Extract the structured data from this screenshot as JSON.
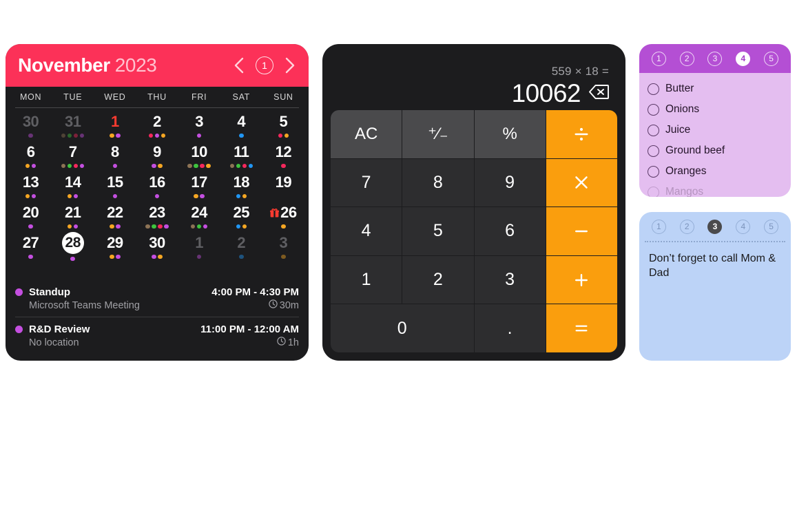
{
  "calendar": {
    "header": {
      "month": "November",
      "year": "2023",
      "prev_icon": "chevron-left-icon",
      "next_icon": "chevron-right-icon",
      "page_indicator": "1",
      "bg_color": "#fc3158"
    },
    "weekdays": [
      "MON",
      "TUE",
      "WED",
      "THU",
      "FRI",
      "SAT",
      "SUN"
    ],
    "dot_colors": {
      "purple": "#c44fe0",
      "orange": "#f5a623",
      "pink": "#f5285c",
      "brown": "#8d7355",
      "green": "#3ec33e",
      "blue": "#2196f3"
    },
    "days": [
      {
        "num": "30",
        "state": "dim",
        "dots": [
          "purple"
        ]
      },
      {
        "num": "31",
        "state": "dim",
        "dots": [
          "brown",
          "green",
          "pink",
          "purple"
        ]
      },
      {
        "num": "1",
        "state": "accent",
        "dots": [
          "orange",
          "purple"
        ]
      },
      {
        "num": "2",
        "state": "normal",
        "dots": [
          "pink",
          "purple",
          "orange"
        ]
      },
      {
        "num": "3",
        "state": "normal",
        "dots": [
          "purple"
        ]
      },
      {
        "num": "4",
        "state": "normal",
        "dots": [
          "blue"
        ]
      },
      {
        "num": "5",
        "state": "normal",
        "dots": [
          "pink",
          "orange"
        ]
      },
      {
        "num": "6",
        "state": "normal",
        "dots": [
          "orange",
          "purple"
        ]
      },
      {
        "num": "7",
        "state": "normal",
        "dots": [
          "brown",
          "green",
          "pink",
          "purple"
        ]
      },
      {
        "num": "8",
        "state": "normal",
        "dots": [
          "purple"
        ]
      },
      {
        "num": "9",
        "state": "normal",
        "dots": [
          "purple",
          "orange"
        ]
      },
      {
        "num": "10",
        "state": "normal",
        "dots": [
          "brown",
          "green",
          "pink",
          "orange"
        ]
      },
      {
        "num": "11",
        "state": "normal",
        "dots": [
          "brown",
          "green",
          "pink",
          "blue"
        ]
      },
      {
        "num": "12",
        "state": "normal",
        "dots": [
          "pink"
        ]
      },
      {
        "num": "13",
        "state": "normal",
        "dots": [
          "orange",
          "purple"
        ]
      },
      {
        "num": "14",
        "state": "normal",
        "dots": [
          "orange",
          "purple"
        ]
      },
      {
        "num": "15",
        "state": "normal",
        "dots": [
          "purple"
        ]
      },
      {
        "num": "16",
        "state": "normal",
        "dots": [
          "purple"
        ]
      },
      {
        "num": "17",
        "state": "normal",
        "dots": [
          "orange",
          "purple"
        ]
      },
      {
        "num": "18",
        "state": "normal",
        "dots": [
          "blue",
          "orange"
        ]
      },
      {
        "num": "19",
        "state": "normal",
        "dots": []
      },
      {
        "num": "20",
        "state": "normal",
        "dots": [
          "purple"
        ]
      },
      {
        "num": "21",
        "state": "normal",
        "dots": [
          "orange",
          "purple"
        ]
      },
      {
        "num": "22",
        "state": "normal",
        "dots": [
          "orange",
          "purple"
        ]
      },
      {
        "num": "23",
        "state": "normal",
        "dots": [
          "brown",
          "green",
          "pink",
          "purple"
        ]
      },
      {
        "num": "24",
        "state": "normal",
        "dots": [
          "brown",
          "green",
          "purple"
        ]
      },
      {
        "num": "25",
        "state": "normal",
        "dots": [
          "blue",
          "orange"
        ]
      },
      {
        "num": "26",
        "state": "normal",
        "dots": [
          "orange"
        ],
        "icon": "gift-icon"
      },
      {
        "num": "27",
        "state": "normal",
        "dots": [
          "purple"
        ]
      },
      {
        "num": "28",
        "state": "today",
        "dots": [
          "purple"
        ]
      },
      {
        "num": "29",
        "state": "normal",
        "dots": [
          "orange",
          "purple"
        ]
      },
      {
        "num": "30",
        "state": "normal",
        "dots": [
          "purple",
          "orange"
        ]
      },
      {
        "num": "1",
        "state": "dim",
        "dots": [
          "purple"
        ]
      },
      {
        "num": "2",
        "state": "dim",
        "dots": [
          "blue"
        ]
      },
      {
        "num": "3",
        "state": "dim",
        "dots": [
          "orange"
        ]
      }
    ],
    "events": [
      {
        "dot_color": "#c44fe0",
        "title": "Standup",
        "location": "Microsoft Teams Meeting",
        "time": "4:00 PM - 4:30 PM",
        "duration": "30m",
        "duration_icon": "clock-icon"
      },
      {
        "dot_color": "#c44fe0",
        "title": "R&D Review",
        "location": "No location",
        "time": "11:00 PM - 12:00 AM",
        "duration": "1h",
        "duration_icon": "clock-icon"
      }
    ]
  },
  "calculator": {
    "display": {
      "expression": "559 × 18 =",
      "result": "10062",
      "backspace_icon": "backspace-icon"
    },
    "accent_color": "#fa9e0d",
    "keys": [
      {
        "label": "AC",
        "type": "fn",
        "name": "all-clear"
      },
      {
        "label": "⁺⁄₋",
        "type": "fn",
        "name": "sign-toggle"
      },
      {
        "label": "%",
        "type": "fn",
        "name": "percent"
      },
      {
        "label": "÷",
        "type": "op",
        "name": "divide"
      },
      {
        "label": "7",
        "type": "digit",
        "name": "seven"
      },
      {
        "label": "8",
        "type": "digit",
        "name": "eight"
      },
      {
        "label": "9",
        "type": "digit",
        "name": "nine"
      },
      {
        "label": "×",
        "type": "op",
        "name": "multiply"
      },
      {
        "label": "4",
        "type": "digit",
        "name": "four"
      },
      {
        "label": "5",
        "type": "digit",
        "name": "five"
      },
      {
        "label": "6",
        "type": "digit",
        "name": "six"
      },
      {
        "label": "−",
        "type": "op",
        "name": "subtract"
      },
      {
        "label": "1",
        "type": "digit",
        "name": "one"
      },
      {
        "label": "2",
        "type": "digit",
        "name": "two"
      },
      {
        "label": "3",
        "type": "digit",
        "name": "three"
      },
      {
        "label": "+",
        "type": "op",
        "name": "add"
      },
      {
        "label": "0",
        "type": "digit wide",
        "name": "zero"
      },
      {
        "label": ".",
        "type": "digit",
        "name": "decimal"
      },
      {
        "label": "=",
        "type": "op",
        "name": "equals"
      }
    ]
  },
  "reminders": {
    "pages": [
      "1",
      "2",
      "3",
      "4",
      "5"
    ],
    "active_page": "4",
    "header_color": "#b44fd4",
    "body_color": "#e4bef0",
    "items": [
      {
        "label": "Butter",
        "checked": false
      },
      {
        "label": "Onions",
        "checked": false
      },
      {
        "label": "Juice",
        "checked": false
      },
      {
        "label": "Ground beef",
        "checked": false
      },
      {
        "label": "Oranges",
        "checked": false
      },
      {
        "label": "Mangos",
        "checked": false
      }
    ]
  },
  "note": {
    "pages": [
      "1",
      "2",
      "3",
      "4",
      "5"
    ],
    "active_page": "3",
    "bg_color": "#bcd3f7",
    "text": "Don’t forget to call Mom & Dad"
  }
}
